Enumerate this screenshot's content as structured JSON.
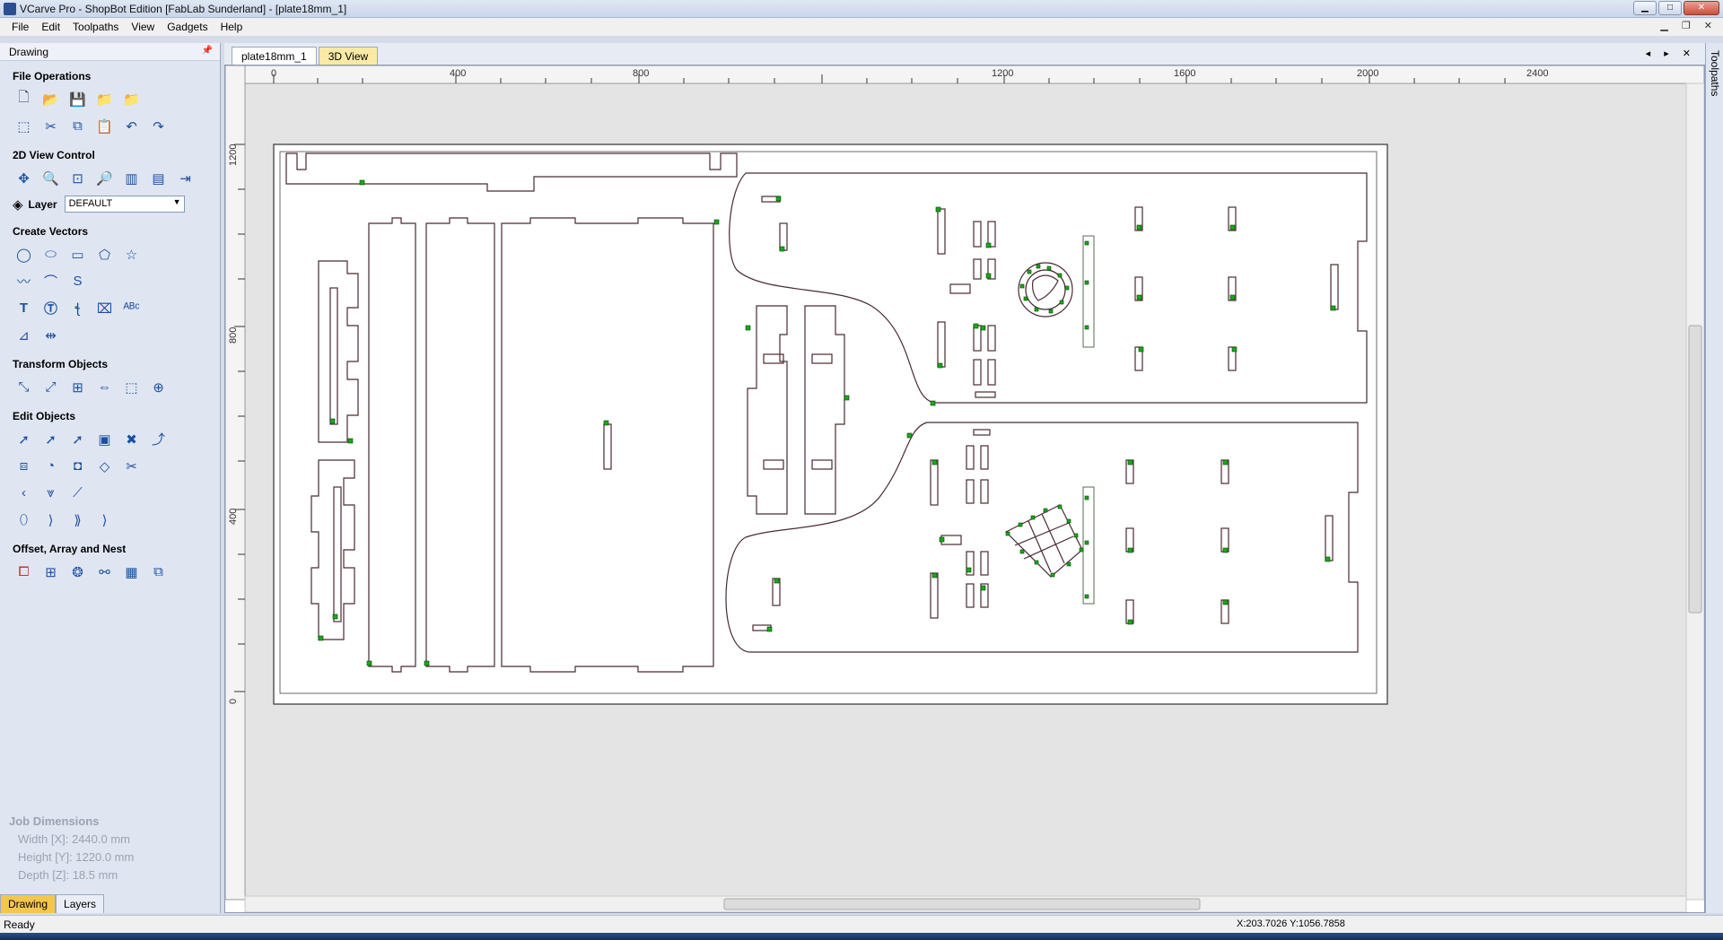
{
  "window": {
    "title": "VCarve Pro - ShopBot Edition [FabLab Sunderland] - [plate18mm_1]"
  },
  "menu": {
    "items": [
      "File",
      "Edit",
      "Toolpaths",
      "View",
      "Gadgets",
      "Help"
    ]
  },
  "left_panel": {
    "header": "Drawing",
    "sections": {
      "file_operations": "File Operations",
      "view_control": "2D View Control",
      "create_vectors": "Create Vectors",
      "transform_objects": "Transform Objects",
      "edit_objects": "Edit Objects",
      "offset_array_nest": "Offset, Array and Nest"
    },
    "layer": {
      "label": "Layer",
      "value": "DEFAULT"
    },
    "job_dimensions": {
      "title": "Job Dimensions",
      "width": "Width  [X]: 2440.0 mm",
      "height": "Height [Y]: 1220.0 mm",
      "depth": "Depth  [Z]: 18.5 mm"
    },
    "bottom_tabs": [
      "Drawing",
      "Layers"
    ]
  },
  "document": {
    "tabs": [
      "plate18mm_1",
      "3D View"
    ],
    "ruler_x_labels": [
      "0",
      "400",
      "800",
      "1200",
      "1600",
      "2000",
      "2400"
    ],
    "ruler_y_labels": [
      "1200",
      "800",
      "400",
      "0"
    ]
  },
  "right_panel": {
    "label": "Toolpaths"
  },
  "status": {
    "text": "Ready",
    "coords": "X:203.7026 Y:1056.7858"
  }
}
